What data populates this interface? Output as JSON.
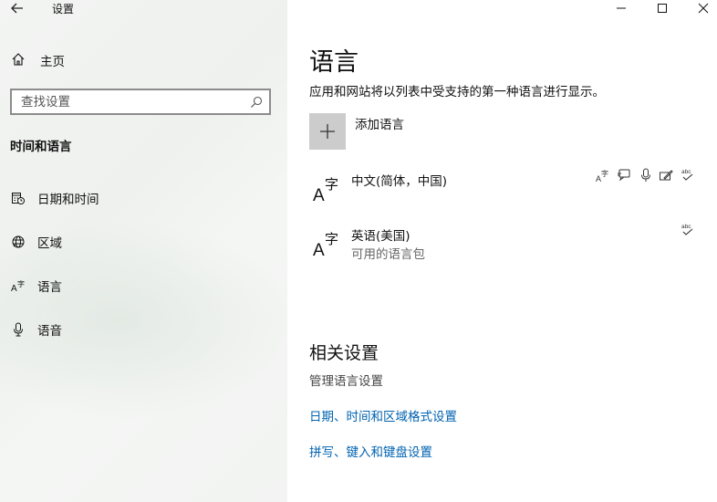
{
  "window": {
    "title": "设置",
    "controls": {
      "minimize": "minimize-icon",
      "maximize": "maximize-icon",
      "close": "close-icon"
    }
  },
  "sidebar": {
    "home_label": "主页",
    "search_placeholder": "查找设置",
    "section_label": "时间和语言",
    "items": [
      {
        "label": "日期和时间",
        "icon": "calendar-clock-icon"
      },
      {
        "label": "区域",
        "icon": "globe-icon"
      },
      {
        "label": "语言",
        "icon": "language-icon"
      },
      {
        "label": "语音",
        "icon": "microphone-icon"
      }
    ]
  },
  "main": {
    "title": "语言",
    "description": "应用和网站将以列表中受支持的第一种语言进行显示。",
    "add_language_label": "添加语言",
    "languages": [
      {
        "name": "中文(简体，中国)",
        "status": "",
        "features": [
          "display-language-icon",
          "speech-bubble-icon",
          "microphone-icon",
          "handwriting-icon",
          "spellcheck-icon"
        ]
      },
      {
        "name": "英语(美国)",
        "status": "可用的语言包",
        "features": [
          "spellcheck-icon"
        ]
      }
    ]
  },
  "related": {
    "title": "相关设置",
    "subtitle": "管理语言设置",
    "links": [
      "日期、时间和区域格式设置",
      "拼写、键入和键盘设置"
    ]
  },
  "colors": {
    "link": "#0063b1",
    "sidebar_bg": "#f2f3f2",
    "add_button_bg": "#cccccc"
  }
}
